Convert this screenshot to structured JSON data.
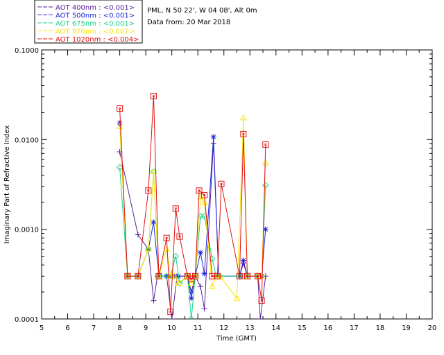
{
  "chart_data": {
    "type": "line",
    "title_lines": [
      "PML, N 50 22', W 04 08', Alt 0m",
      "Data from: 20 Mar 2018"
    ],
    "xlabel": "Time (GMT)",
    "ylabel": "Imaginary Part of Refractive Index",
    "xlim": [
      5,
      20
    ],
    "ylim": [
      0.0001,
      0.1
    ],
    "yscale": "log",
    "grid": false,
    "legend_placement": "top-left",
    "x_ticks": [
      "5",
      "6",
      "7",
      "8",
      "9",
      "10",
      "11",
      "12",
      "13",
      "14",
      "15",
      "16",
      "17",
      "18",
      "19",
      "20"
    ],
    "y_ticks": [
      "0.0001",
      "0.0010",
      "0.0100",
      "0.1000"
    ],
    "series": [
      {
        "name": "AOT  400nm : <0.001>",
        "color": "#5a1f9e",
        "marker": "plus",
        "points": [
          [
            8.0,
            0.0073
          ],
          [
            8.7,
            0.00087
          ],
          [
            9.1,
            0.0006
          ],
          [
            9.3,
            0.00016
          ],
          [
            9.45,
            0.0003
          ],
          [
            9.8,
            0.0003
          ],
          [
            10.0,
            0.0001
          ],
          [
            10.2,
            0.0003
          ],
          [
            10.6,
            0.0003
          ],
          [
            10.75,
            0.0002
          ],
          [
            10.9,
            0.0003
          ],
          [
            11.1,
            0.00023
          ],
          [
            11.25,
            0.00013
          ],
          [
            11.6,
            0.0091
          ],
          [
            11.8,
            0.0003
          ],
          [
            12.6,
            0.0003
          ],
          [
            12.75,
            0.00042
          ],
          [
            12.9,
            0.0003
          ],
          [
            13.3,
            0.0003
          ],
          [
            13.4,
            0.0001
          ],
          [
            13.6,
            0.0003
          ]
        ]
      },
      {
        "name": "AOT  500nm : <0.001>",
        "color": "#1c28d9",
        "marker": "star",
        "points": [
          [
            8.0,
            0.0153
          ],
          [
            8.3,
            0.0003
          ],
          [
            8.7,
            0.0003
          ],
          [
            9.1,
            0.0006
          ],
          [
            9.3,
            0.0012
          ],
          [
            9.5,
            0.0003
          ],
          [
            9.8,
            0.0003
          ],
          [
            9.95,
            0.0003
          ],
          [
            10.1,
            0.0003
          ],
          [
            10.25,
            0.0003
          ],
          [
            10.6,
            0.0003
          ],
          [
            10.75,
            0.00017
          ],
          [
            10.9,
            0.0003
          ],
          [
            11.1,
            0.00055
          ],
          [
            11.25,
            0.00032
          ],
          [
            11.6,
            0.0107
          ],
          [
            11.8,
            0.0003
          ],
          [
            12.6,
            0.0003
          ],
          [
            12.75,
            0.00045
          ],
          [
            12.9,
            0.0003
          ],
          [
            13.3,
            0.0003
          ],
          [
            13.45,
            0.0003
          ],
          [
            13.6,
            0.001
          ]
        ]
      },
      {
        "name": "AOT  675nm : <0.001>",
        "color": "#19d48a",
        "marker": "diamond",
        "points": [
          [
            8.0,
            0.0049
          ],
          [
            8.3,
            0.0003
          ],
          [
            8.7,
            0.0003
          ],
          [
            9.1,
            0.0006
          ],
          [
            9.3,
            0.0044
          ],
          [
            9.5,
            0.0003
          ],
          [
            9.8,
            0.0003
          ],
          [
            9.95,
            0.0003
          ],
          [
            10.15,
            0.0005
          ],
          [
            10.3,
            0.00025
          ],
          [
            10.6,
            0.0003
          ],
          [
            10.75,
            0.0001
          ],
          [
            10.9,
            0.0003
          ],
          [
            11.1,
            0.0014
          ],
          [
            11.25,
            0.0014
          ],
          [
            11.55,
            0.00047
          ],
          [
            11.7,
            0.0003
          ],
          [
            11.85,
            0.0003
          ],
          [
            12.6,
            0.0003
          ],
          [
            12.75,
            0.0003
          ],
          [
            12.9,
            0.0003
          ],
          [
            13.3,
            0.0003
          ],
          [
            13.45,
            0.0003
          ],
          [
            13.6,
            0.0031
          ]
        ]
      },
      {
        "name": "AOT  870nm : <0.002>",
        "color": "#ffe600",
        "marker": "triangle",
        "points": [
          [
            8.0,
            0.014
          ],
          [
            8.3,
            0.0003
          ],
          [
            8.7,
            0.0003
          ],
          [
            9.1,
            0.0006
          ],
          [
            9.3,
            0.0044
          ],
          [
            9.5,
            0.0003
          ],
          [
            9.8,
            0.0006
          ],
          [
            9.95,
            0.0003
          ],
          [
            10.1,
            0.0003
          ],
          [
            10.25,
            0.00025
          ],
          [
            10.6,
            0.0003
          ],
          [
            10.75,
            0.00025
          ],
          [
            10.9,
            0.0003
          ],
          [
            11.1,
            0.0023
          ],
          [
            11.25,
            0.002
          ],
          [
            11.55,
            0.00023
          ],
          [
            11.7,
            0.0003
          ],
          [
            11.85,
            0.0003
          ],
          [
            12.5,
            0.00017
          ],
          [
            12.75,
            0.0175
          ],
          [
            12.9,
            0.0003
          ],
          [
            13.3,
            0.0003
          ],
          [
            13.45,
            0.0003
          ],
          [
            13.6,
            0.0055
          ]
        ]
      },
      {
        "name": "AOT 1020nm : <0.004>",
        "color": "#e01010",
        "marker": "square",
        "points": [
          [
            8.0,
            0.0222
          ],
          [
            8.3,
            0.0003
          ],
          [
            8.7,
            0.0003
          ],
          [
            9.1,
            0.0027
          ],
          [
            9.3,
            0.0305
          ],
          [
            9.5,
            0.0003
          ],
          [
            9.8,
            0.0008
          ],
          [
            9.95,
            0.00012
          ],
          [
            10.15,
            0.0017
          ],
          [
            10.3,
            0.00083
          ],
          [
            10.6,
            0.0003
          ],
          [
            10.75,
            0.00028
          ],
          [
            10.9,
            0.0003
          ],
          [
            11.05,
            0.0027
          ],
          [
            11.25,
            0.0024
          ],
          [
            11.55,
            0.0003
          ],
          [
            11.75,
            0.0003
          ],
          [
            11.9,
            0.0032
          ],
          [
            12.6,
            0.0003
          ],
          [
            12.75,
            0.0115
          ],
          [
            12.9,
            0.0003
          ],
          [
            13.3,
            0.0003
          ],
          [
            13.45,
            0.00016
          ],
          [
            13.6,
            0.0088
          ]
        ]
      }
    ]
  }
}
